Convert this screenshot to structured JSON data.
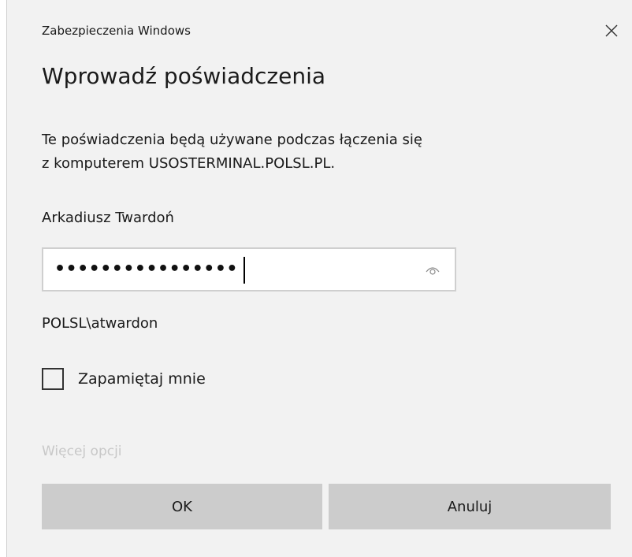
{
  "dialog": {
    "app_title": "Zabezpieczenia Windows",
    "heading": "Wprowadź poświadczenia",
    "description_line1": "Te poświadczenia będą używane podczas łączenia się",
    "description_line2": "z komputerem USOSTERMINAL.POLSL.PL.",
    "username": "Arkadiusz Twardoń",
    "password_masked": "••••••••••••••••",
    "domain_user": "POLSL\\atwardon",
    "remember_label": "Zapamiętaj mnie",
    "remember_checked": false,
    "more_options": "Więcej opcji",
    "ok_label": "OK",
    "cancel_label": "Anuluj"
  },
  "icons": {
    "close": "close-icon",
    "reveal": "eye-reveal-icon"
  },
  "colors": {
    "background": "#f2f2f2",
    "button": "#cccccc",
    "disabled_text": "#c8c8c8",
    "input_border": "#cfcfcf"
  }
}
